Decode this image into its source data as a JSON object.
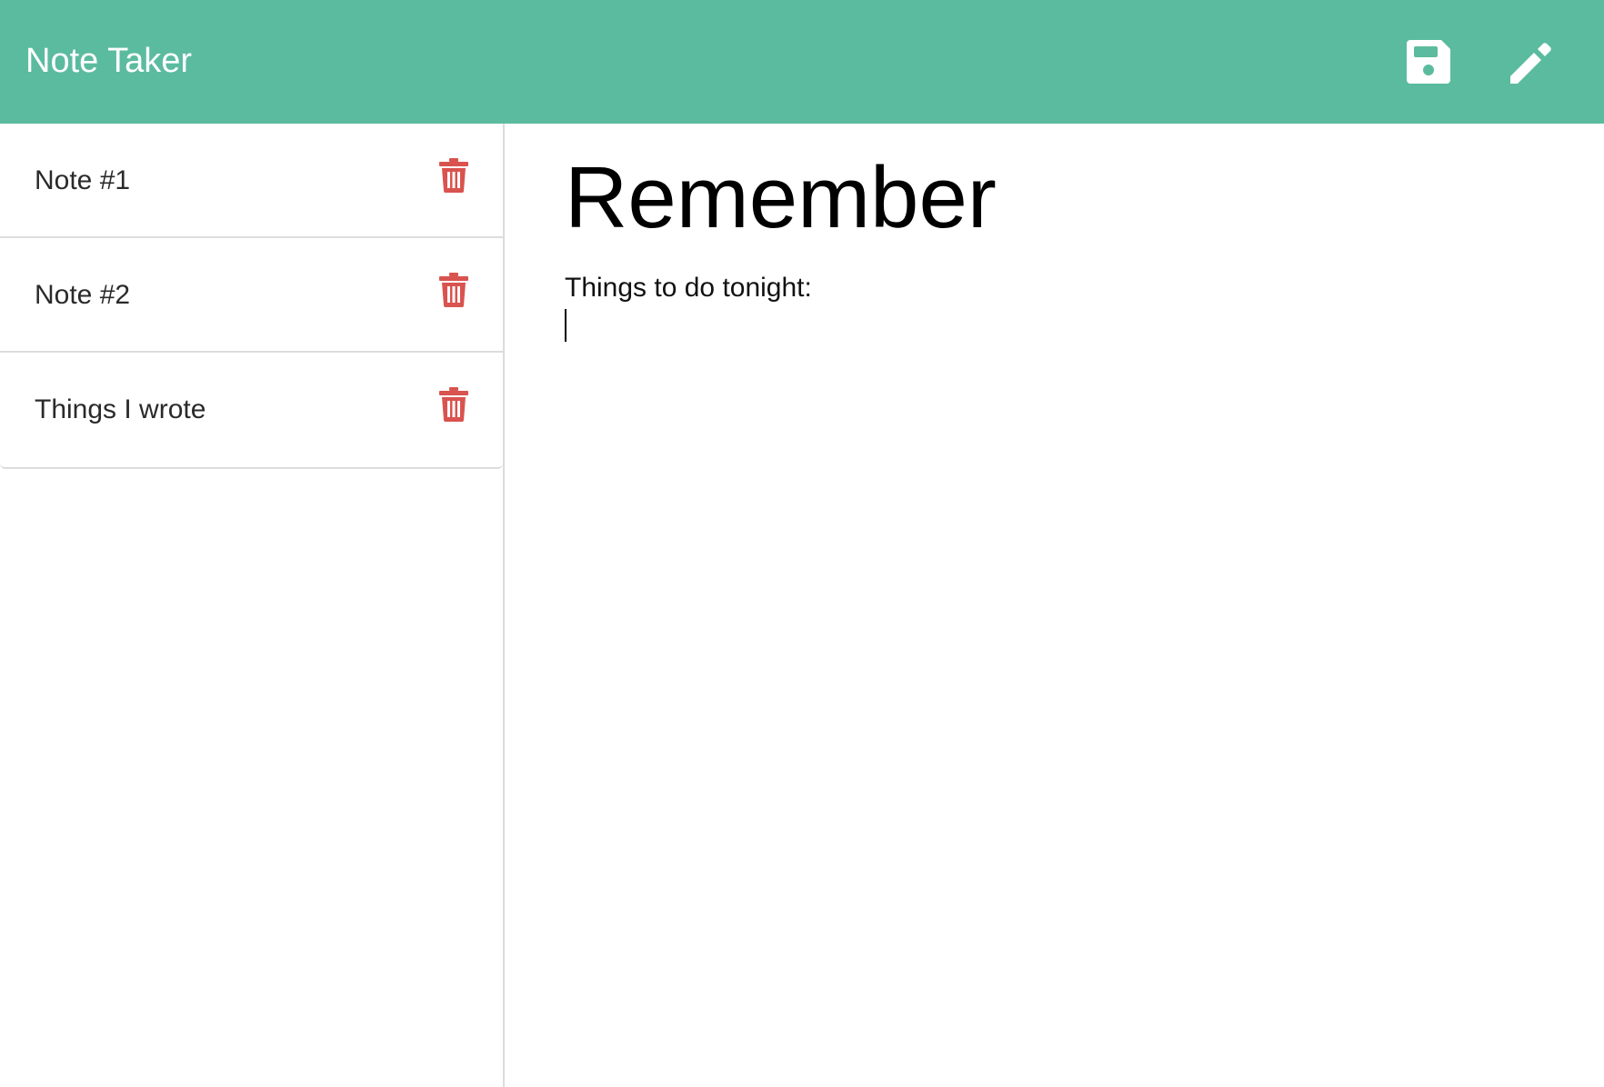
{
  "navbar": {
    "title": "Note Taker",
    "save_icon": "floppy-disk-icon",
    "edit_icon": "pencil-icon",
    "background_color": "#5bbb9e"
  },
  "sidebar": {
    "notes": [
      {
        "title": "Note #1",
        "delete_icon": "trash-icon"
      },
      {
        "title": "Note #2",
        "delete_icon": "trash-icon"
      },
      {
        "title": "Things I wrote",
        "delete_icon": "trash-icon"
      }
    ],
    "delete_color": "#d9534f"
  },
  "editor": {
    "title": "Remember",
    "body": "Things to do tonight:\n"
  }
}
